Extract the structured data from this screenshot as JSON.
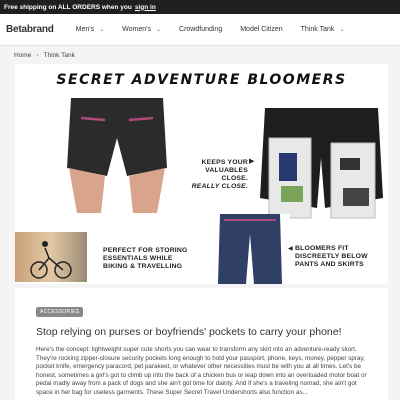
{
  "topbar": {
    "text": "Free shipping on ALL ORDERS when you",
    "link": "sign in"
  },
  "nav": {
    "logo": "Betabrand",
    "items": [
      {
        "label": "Men's",
        "chevron": true
      },
      {
        "label": "Women's",
        "chevron": true
      },
      {
        "label": "Crowdfunding",
        "chevron": false
      },
      {
        "label": "Model Citizen",
        "chevron": false
      },
      {
        "label": "Think Tank",
        "chevron": true
      }
    ]
  },
  "breadcrumb": {
    "home": "Home",
    "current": "Think Tank"
  },
  "hero": {
    "title": "SECRET ADVENTURE BLOOMERS",
    "caption_keep_1": "KEEPS YOUR",
    "caption_keep_2": "VALUABLES CLOSE.",
    "caption_keep_3": "REALLY CLOSE.",
    "caption_bike_1": "PERFECT FOR STORING",
    "caption_bike_2": "ESSENTIALS WHILE",
    "caption_bike_3": "BIKING & TRAVELLING",
    "caption_fit_1": "BLOOMERS FIT",
    "caption_fit_2": "DISCREETLY BELOW",
    "caption_fit_3": "PANTS AND SKIRTS"
  },
  "article": {
    "badge": "ACCESSORIES",
    "headline": "Stop relying on purses or boyfriends' pockets to carry your phone!",
    "body": "Here's the concept: lightweight super cute shorts you can wear to transform any skirt into an adventure-ready skort. They're rocking zipper-closure security pockets long enough to hold your passport, phone, keys, money, pepper spray, pocket knife, emergency paracord, pet parakeet, or whatever other necessities must be with you at all times. Let's be honest, sometimes a girl's got to climb up into the back of a chicken bus or leap down into an overloaded motor boat or pedal madly away from a pack of dogs and she ain't got time for dainty. And if she's a traveling nomad, she ain't got space in her bag for useless garments. These Super Secret Travel Undershorts also function as..."
  },
  "icons": {
    "chevron": "chevron-down-icon",
    "breadcrumb_sep": "chevron-right-icon"
  }
}
